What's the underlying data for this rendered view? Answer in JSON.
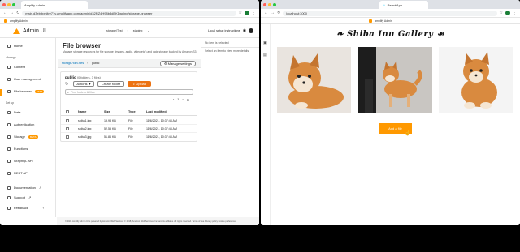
{
  "left_window": {
    "tab_title": "Amplify Admin",
    "url": "main.d3ebfbxnltry7?v.amplifyapp.com/admin/d32RZ4H98b8dEKDaging/storage-browser",
    "bookmark": "amplify Admin",
    "app_title": "Admin UI",
    "env_crumbs": [
      "storage/Test",
      "staging"
    ],
    "local_setup": "Local setup instructions",
    "sidebar": {
      "items_top": [
        {
          "label": "Home",
          "icon": "home-icon"
        }
      ],
      "manage_heading": "Manage",
      "manage_items": [
        {
          "label": "Content",
          "icon": "content-icon"
        },
        {
          "label": "User management",
          "icon": "users-icon"
        },
        {
          "label": "File browser",
          "icon": "file-icon",
          "badge": "BETA"
        }
      ],
      "setup_heading": "Set up",
      "setup_items": [
        {
          "label": "Data",
          "icon": "data-icon"
        },
        {
          "label": "Authentication",
          "icon": "auth-icon"
        },
        {
          "label": "Storage",
          "icon": "storage-icon",
          "badge": "BETA"
        },
        {
          "label": "Functions",
          "icon": "lambda-icon"
        },
        {
          "label": "GraphQL API",
          "icon": "graphql-icon"
        },
        {
          "label": "REST API",
          "icon": "api-icon"
        }
      ],
      "bottom_items": [
        {
          "label": "Documentation",
          "icon": "external-link-icon"
        },
        {
          "label": "Support",
          "icon": "external-link-icon"
        },
        {
          "label": "Feedback",
          "icon": "feedback-icon"
        }
      ]
    },
    "main": {
      "title": "File browser",
      "subtitle": "Manage storage resources for file storage (images, audio, video etc.) and data storage backed by Amazon S3",
      "bucket_crumbs": [
        "storage7kkn-files",
        "public"
      ],
      "manage_settings": "Manage settings",
      "folder_title": "public",
      "folder_count": "(0 folders, 3 files)",
      "actions": "Actions",
      "create_folder": "Create folder",
      "upload": "Upload",
      "search_placeholder": "Find folders & files",
      "page": "1",
      "columns": [
        "Name",
        "Size",
        "Type",
        "Last modified"
      ],
      "files": [
        {
          "name": "shiba1.jpg",
          "size": "19.93 KB",
          "type": "File",
          "modified": "11/6/2021, 10:37:43 AM"
        },
        {
          "name": "shiba2.jpg",
          "size": "52.55 KB",
          "type": "File",
          "modified": "11/6/2021, 10:37:43 AM"
        },
        {
          "name": "shiba3.jpg",
          "size": "51.86 KB",
          "type": "File",
          "modified": "11/6/2021, 10:37:43 AM"
        }
      ]
    },
    "right_panel": {
      "title": "No item is selected",
      "hint": "Select an item to view more details"
    },
    "footer": "© 2021 Amplify Admin UI is powered by Amazon Web Services © 2018, Amazon Web Services, Inc. and its affiliates. All rights reserved. Terms of use Privacy policy Cookie preferences"
  },
  "right_window": {
    "tab_title": "React App",
    "url": "localhost:3000",
    "bookmark": "amplify Admin",
    "gallery_title": "Shiba Inu Gallery",
    "add_button": "Add a file"
  },
  "colors": {
    "accent": "#ff9900",
    "upload": "#ec7211",
    "dog_fur": "#d98a3f",
    "backdrop": "#000000"
  }
}
